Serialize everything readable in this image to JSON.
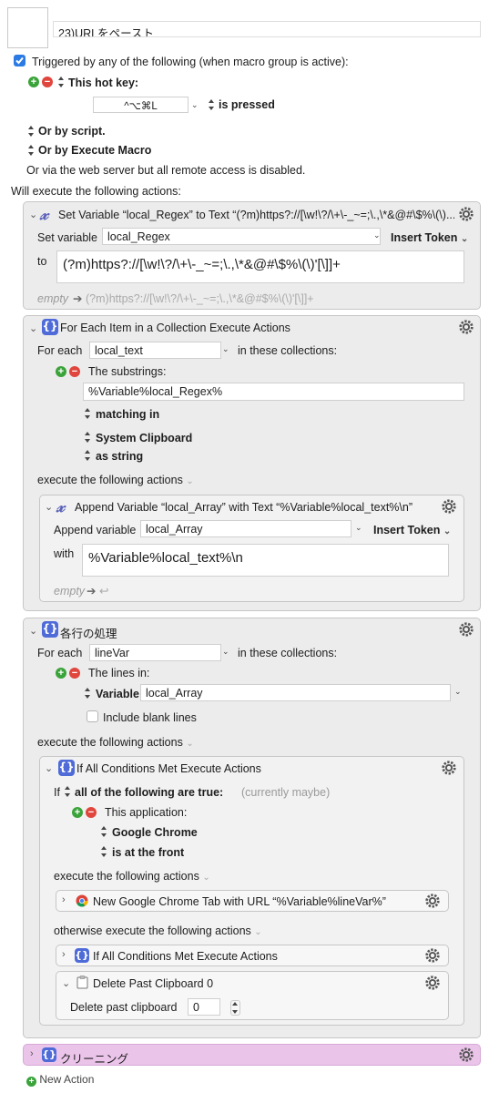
{
  "macro": {
    "name": "23)URLをペースト"
  },
  "trigger": {
    "triggered_label": "Triggered by any of the following (when macro group is active):",
    "hotkey_label": "This hot key:",
    "hotkey_value": "^⌥⌘L",
    "hotkey_state": "is pressed",
    "or_script": "Or by script.",
    "or_execute": "Or by Execute Macro",
    "web_server": "Or via the web server but all remote access is disabled."
  },
  "will_execute": "Will execute the following actions:",
  "a1": {
    "title": "Set Variable “local_Regex” to Text “(?m)https?://[\\w!\\?/\\+\\-_~=;\\.,\\*&@#\\$%\\(\\)...",
    "set_label": "Set variable",
    "var": "local_Regex",
    "insert": "Insert Token",
    "to_label": "to",
    "text": "(?m)https?://[\\w!\\?/\\+\\-_~=;\\.,\\*&@#\\$%\\(\\)'[\\]]+",
    "preview_empty": "empty",
    "preview_text": "(?m)https?://[\\w!\\?/\\+\\-_~=;\\.,\\*&@#$%\\(\\)'[\\]]+"
  },
  "a2": {
    "title": "For Each Item in a Collection Execute Actions",
    "for_each": "For each",
    "var": "local_text",
    "in_coll": "in these collections:",
    "substrings": "The substrings:",
    "regex": "%Variable%local_Regex%",
    "matching": "matching in",
    "clipboard": "System Clipboard",
    "as_string": "as string",
    "exec": "execute the following actions",
    "sub": {
      "title": "Append Variable “local_Array” with Text “%Variable%local_text%\\n”",
      "label": "Append variable",
      "var": "local_Array",
      "insert": "Insert Token",
      "with": "with",
      "text": "%Variable%local_text%\\n",
      "empty": "empty"
    }
  },
  "a3": {
    "title": "各行の処理",
    "for_each": "For each",
    "var": "lineVar",
    "in_coll": "in these collections:",
    "lines_in": "The lines in:",
    "variable": "Variable",
    "var2": "local_Array",
    "blank": "Include blank lines",
    "exec": "execute the following actions",
    "cond": {
      "title": "If All Conditions Met Execute Actions",
      "if": "If",
      "all": "all of the following are true:",
      "currently": "(currently maybe)",
      "this_app": "This application:",
      "app": "Google Chrome",
      "front": "is at the front",
      "exec": "execute the following actions",
      "chrome": "New Google Chrome Tab with URL “%Variable%lineVar%”",
      "otherwise": "otherwise execute the following actions",
      "nested": "If All Conditions Met Execute Actions",
      "delete_title": "Delete Past Clipboard 0",
      "delete_label": "Delete past clipboard",
      "delete_val": "0"
    }
  },
  "a4": {
    "title": "クリーニング"
  },
  "new_action": "New Action",
  "colors": {
    "accent": "#2c7be5",
    "pink": "#ebc4ea",
    "plus": "#3aa33a",
    "minus": "#e0463d",
    "brace": "#4e6bd8"
  }
}
